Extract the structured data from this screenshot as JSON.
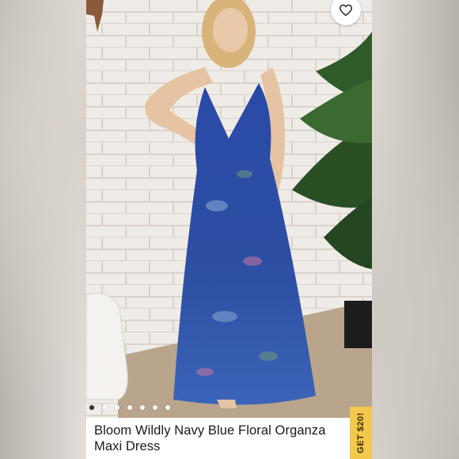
{
  "listing": {
    "title": "Bloom Wildly Navy Blue Floral Organza Maxi Dress",
    "carousel": {
      "count": 7,
      "active_index": 0
    },
    "promo_tab": "GET $20!",
    "like_icon": "heart-outline-icon"
  },
  "colors": {
    "dress": "#2b4a9e",
    "promo": "#f2c94c",
    "wall": "#ece7e1"
  }
}
